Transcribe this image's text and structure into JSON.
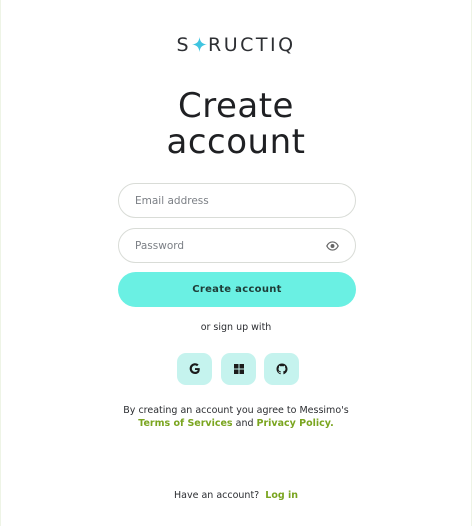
{
  "brand": {
    "logo_left": "S",
    "logo_right": "RUCTIQ",
    "accent": "#3fc4e0"
  },
  "heading": {
    "line1": "Create",
    "line2": "account"
  },
  "form": {
    "email_placeholder": "Email address",
    "password_placeholder": "Password",
    "password_toggle_icon": "eye-icon",
    "submit_label": "Create account",
    "submit_color": "#6af0e3"
  },
  "social": {
    "divider_text": "or sign up with",
    "providers": [
      {
        "name": "Google",
        "icon": "google-icon"
      },
      {
        "name": "Microsoft",
        "icon": "windows-icon"
      },
      {
        "name": "GitHub",
        "icon": "github-icon"
      }
    ],
    "button_color": "#c5f3ee"
  },
  "terms": {
    "prefix": "By creating an account you agree to Messimo's",
    "terms_link": "Terms of Services",
    "conjunction": "and",
    "privacy_link": "Privacy Policy.",
    "link_color": "#7aa51f"
  },
  "footer": {
    "question": "Have an account?",
    "login_link": "Log in"
  }
}
